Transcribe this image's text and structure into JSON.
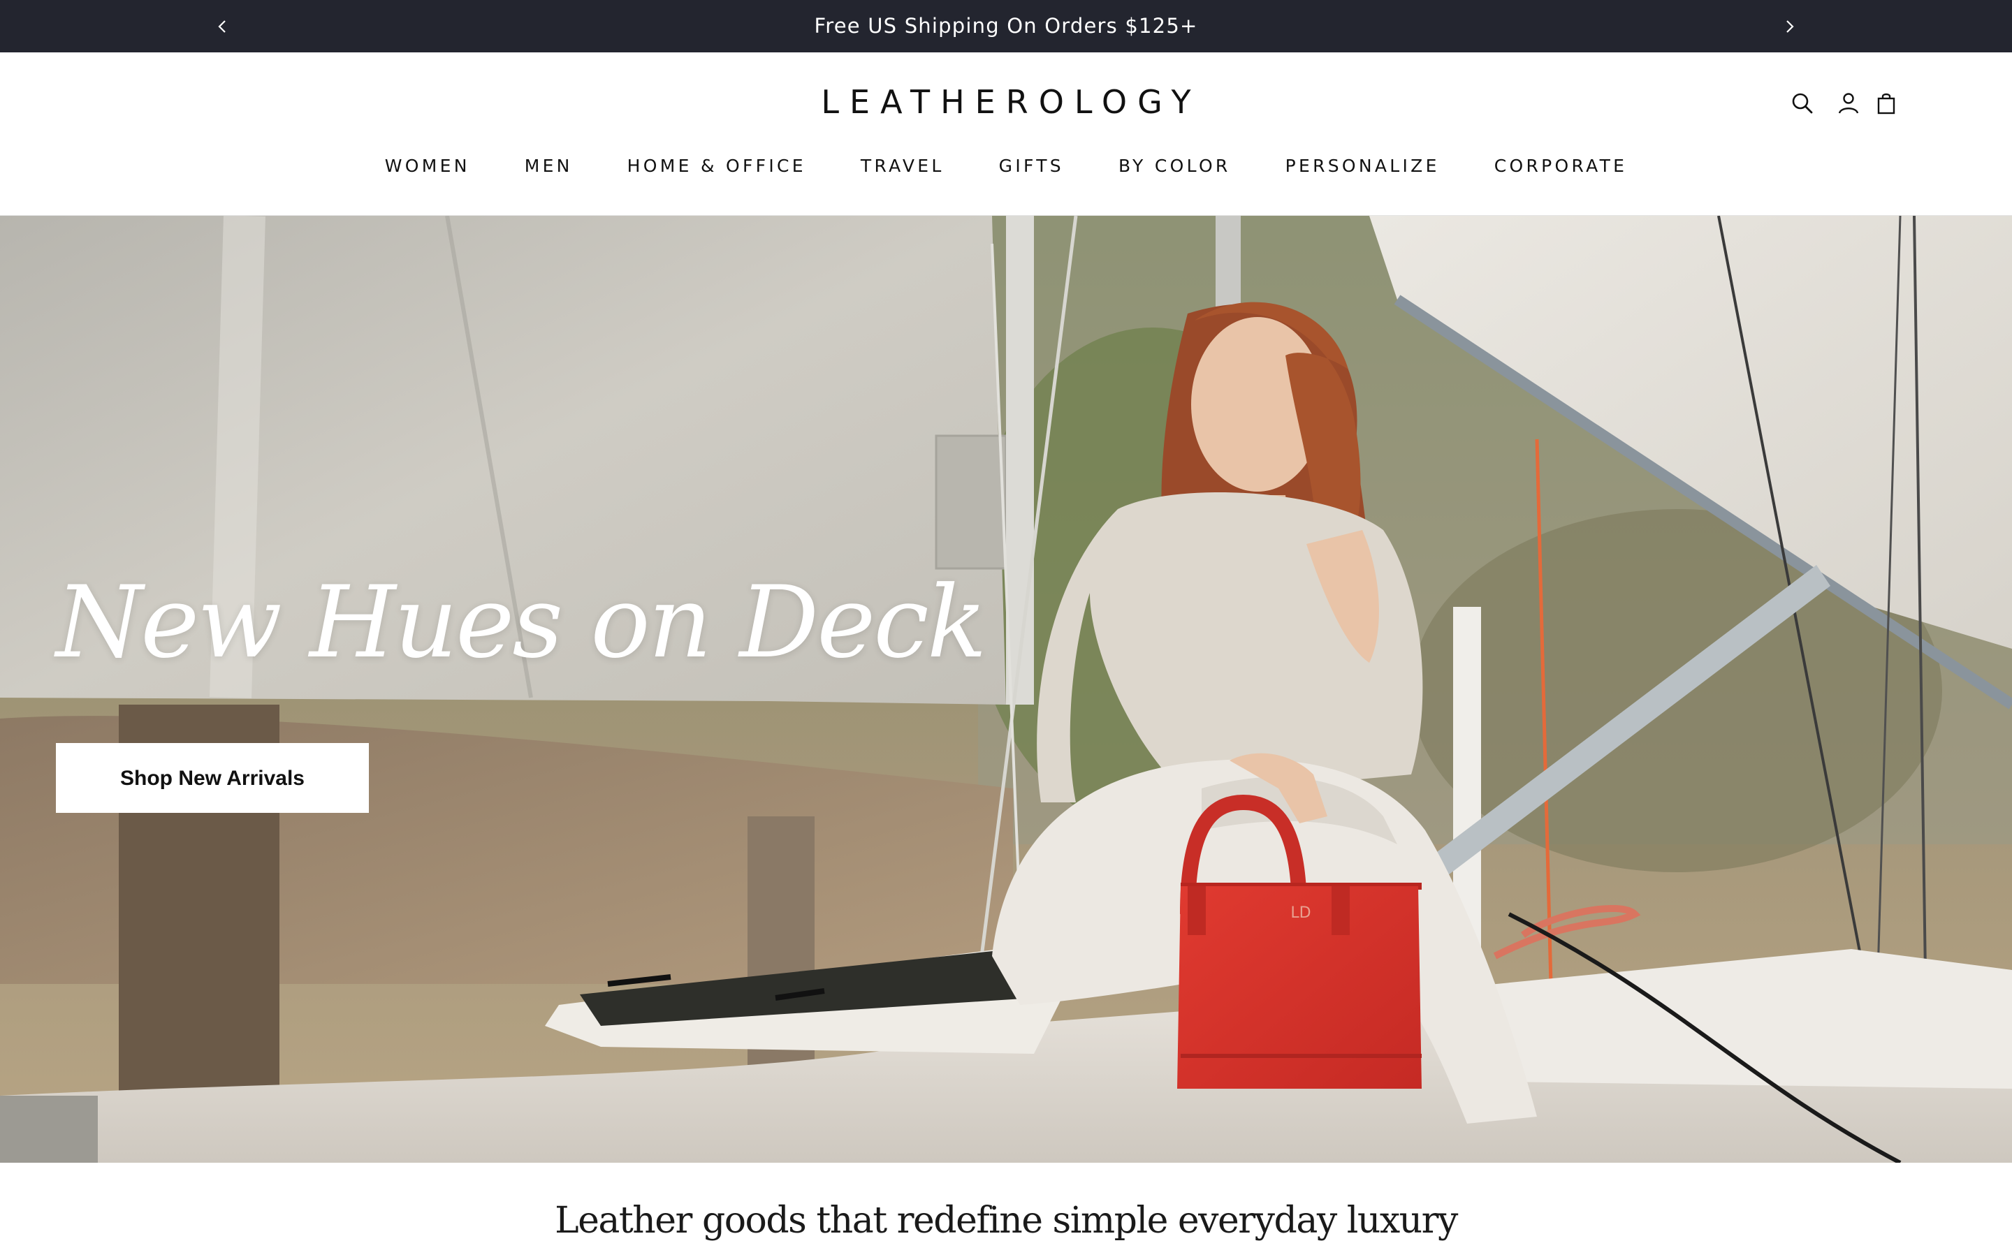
{
  "announcement": {
    "text": "Free US Shipping On Orders $125+",
    "prev_icon": "chevron-left-icon",
    "next_icon": "chevron-right-icon"
  },
  "header": {
    "logo": "LEATHEROLOGY",
    "icons": [
      "search-icon",
      "account-icon",
      "cart-icon"
    ]
  },
  "nav": {
    "items": [
      {
        "label": "WOMEN"
      },
      {
        "label": "MEN"
      },
      {
        "label": "HOME & OFFICE"
      },
      {
        "label": "TRAVEL"
      },
      {
        "label": "GIFTS"
      },
      {
        "label": "BY COLOR"
      },
      {
        "label": "PERSONALIZE"
      },
      {
        "label": "CORPORATE"
      }
    ]
  },
  "hero": {
    "title": "New Hues on Deck",
    "cta_label": "Shop New Arrivals",
    "bag_monogram": "LD"
  },
  "tagline": "Leather goods that redefine simple everyday luxury",
  "colors": {
    "announcement_bg": "#23252f",
    "bag_red": "#d8302a",
    "text": "#111111"
  }
}
